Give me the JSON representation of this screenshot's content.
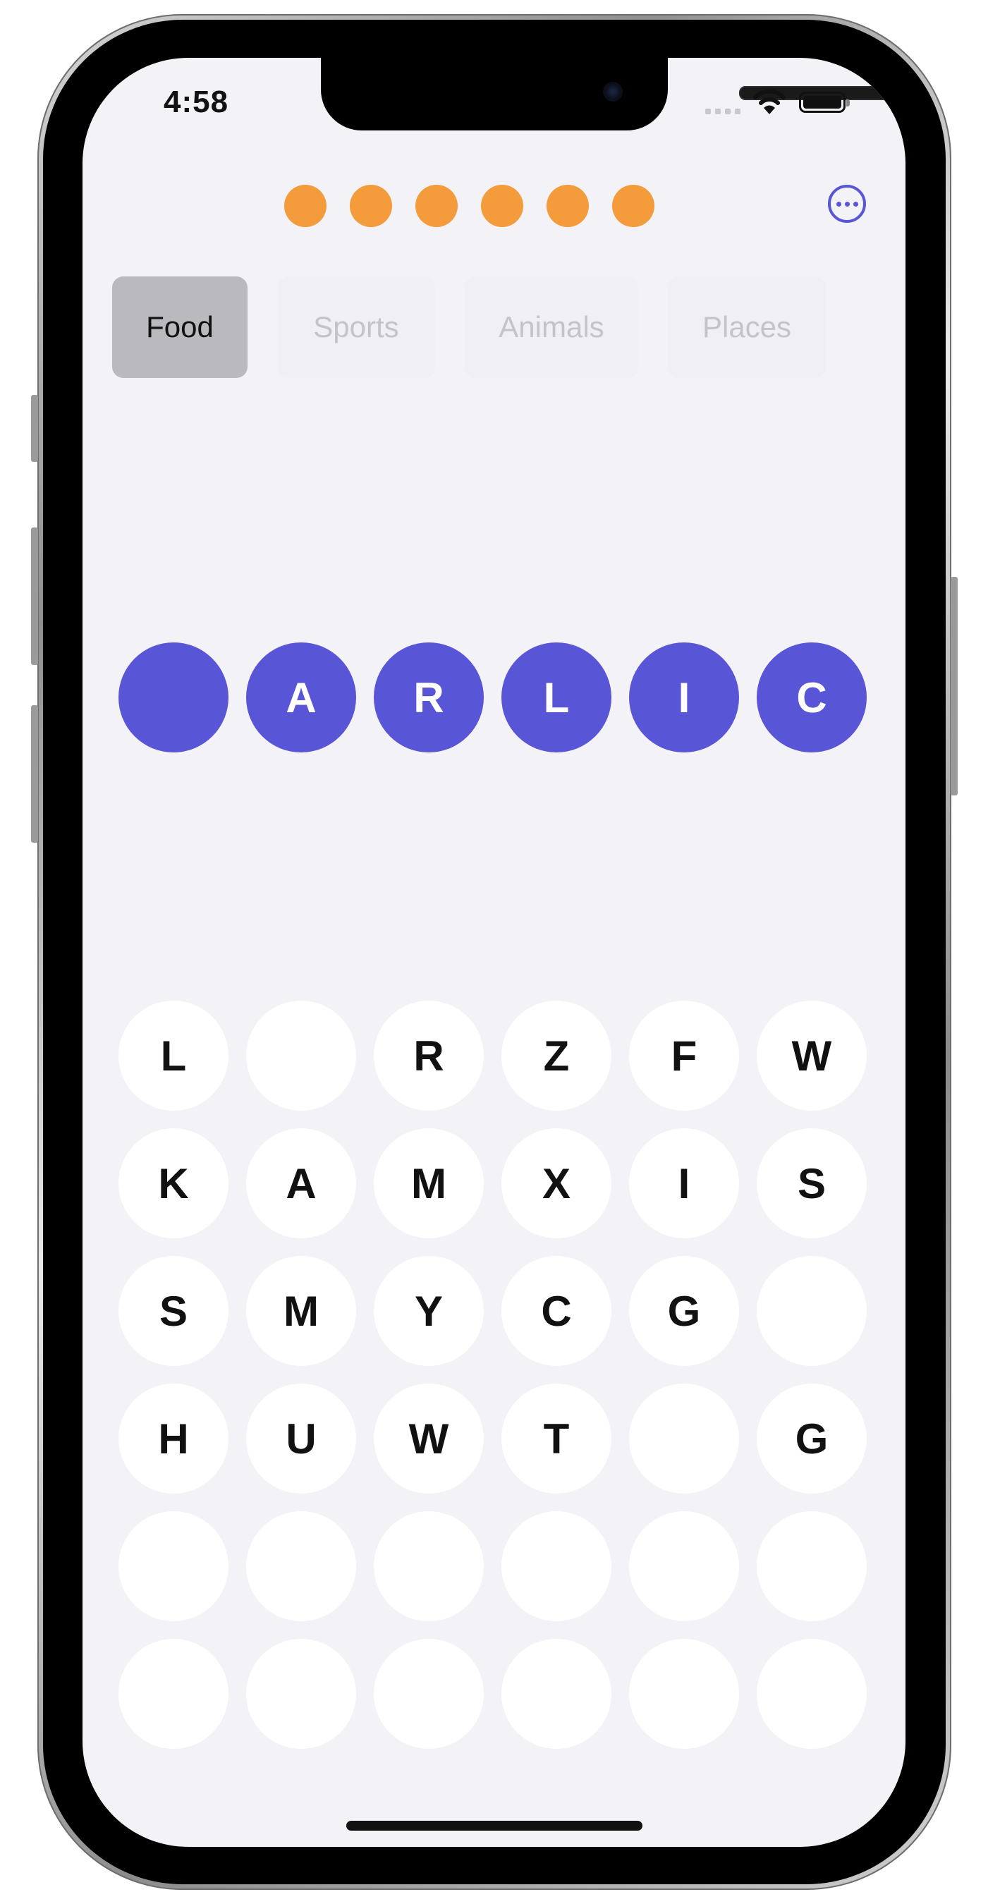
{
  "status_bar": {
    "time": "4:58"
  },
  "lives": {
    "count": 6,
    "color": "#f49b3b"
  },
  "menu": {
    "icon": "ellipsis-circle-icon",
    "color": "#5856d6"
  },
  "categories": [
    {
      "label": "Food",
      "active": true
    },
    {
      "label": "Sports",
      "active": false
    },
    {
      "label": "Animals",
      "active": false
    },
    {
      "label": "Places",
      "active": false
    }
  ],
  "answer": {
    "letters": [
      "",
      "A",
      "R",
      "L",
      "I",
      "C"
    ],
    "color": "#5856d6"
  },
  "letter_grid": {
    "rows": [
      [
        "L",
        "",
        "R",
        "Z",
        "F",
        "W"
      ],
      [
        "K",
        "A",
        "M",
        "X",
        "I",
        "S"
      ],
      [
        "S",
        "M",
        "Y",
        "C",
        "G",
        ""
      ],
      [
        "H",
        "U",
        "W",
        "T",
        "",
        "G"
      ],
      [
        "",
        "",
        "",
        "",
        "",
        ""
      ],
      [
        "",
        "",
        "",
        "",
        "",
        ""
      ]
    ]
  }
}
